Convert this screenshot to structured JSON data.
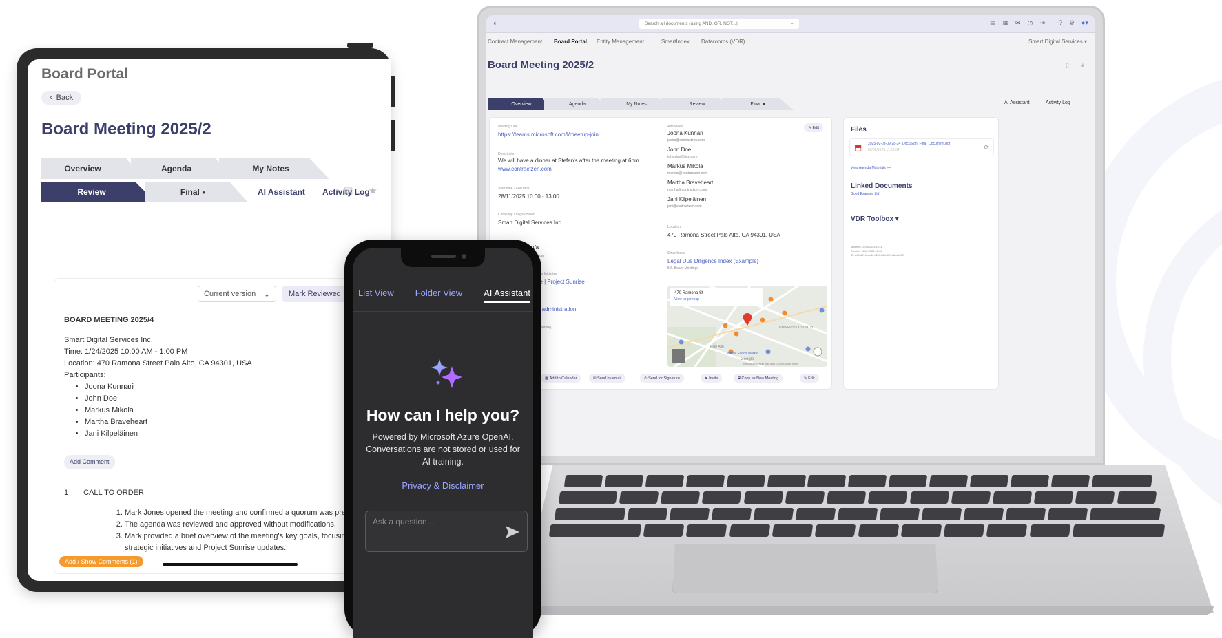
{
  "tablet": {
    "app_title": "Board Portal",
    "back_label": "Back",
    "meeting_title": "Board Meeting 2025/2",
    "tabs": [
      "Overview",
      "Agenda",
      "My Notes",
      "Review",
      "Final"
    ],
    "active_tab": "Review",
    "final_dot": "●",
    "links": [
      "AI Assistant",
      "Activity Log"
    ],
    "version_select": "Current version",
    "mark_reviewed": "Mark Reviewed",
    "doc": {
      "heading": "BOARD MEETING 2025/4",
      "company": "Smart Digital Services Inc.",
      "time": "Time: 1/24/2025 10:00 AM - 1:00 PM",
      "location": "Location: 470 Ramona Street  Palo Alto, CA 94301, USA",
      "participants_label": "Participants:",
      "participants": [
        "Joona Kunnari",
        "John Doe",
        "Markus Mikola",
        "Martha Braveheart",
        "Jani Kilpeläinen"
      ],
      "add_comment": "Add Comment",
      "section_number": "1",
      "section_title": "CALL TO ORDER",
      "items": [
        "Mark Jones opened the meeting and confirmed a quorum was present.",
        "The agenda was reviewed and approved without modifications.",
        "Mark provided a brief overview of the meeting's key goals, focusing on strategic initiatives and Project Sunrise updates."
      ],
      "show_comments": "Add / Show Comments (1)"
    }
  },
  "phone": {
    "tabs": [
      "List View",
      "Folder View",
      "AI Assistant"
    ],
    "active_tab": "AI Assistant",
    "heading": "How can I help you?",
    "subtitle": "Powered by Microsoft Azure OpenAI. Conversations are not stored or used for AI training.",
    "link": "Privacy & Disclaimer",
    "input_placeholder": "Ask a question..."
  },
  "laptop": {
    "search_placeholder": "Search all documents (using AND, OR, NOT...)",
    "nav": [
      "Contract Management",
      "Board Portal",
      "Entity Management",
      "SmartIndex",
      "Datarooms (VDR)"
    ],
    "org_selector": "Smart Digital Services ▾",
    "meeting_title": "Board Meeting 2025/2",
    "tabs": [
      "Overview",
      "Agenda",
      "My Notes",
      "Review",
      "Final ●"
    ],
    "links": [
      "AI Assistant",
      "Activity Log"
    ],
    "meeting_link_label": "Meeting Link",
    "meeting_link": "https://teams.microsoft.com/l/meetup-join...",
    "description_label": "Description",
    "description": "We will have a dinner at Stefan's after the meeting at 6pm.",
    "description_link": "www.contractzen.com",
    "time_label": "Start time - End time",
    "time": "28/11/2025 10.00 - 13.00",
    "company_label": "Company / Organization",
    "company": "Smart Digital Services Inc.",
    "partial_texts": [
      "n/a",
      "zen.com",
      "Case or Initiative",
      "ative | Project Sunrise",
      "and administration",
      "(days before)"
    ],
    "edit_label": "Edit",
    "attendees_label": "Attendees",
    "attendees": [
      {
        "name": "Joona Kunnari",
        "email": "joona@contractzen.com"
      },
      {
        "name": "John Doe",
        "email": "john.doe@firm.com"
      },
      {
        "name": "Markus Mikola",
        "email": "markus@contractzen.com"
      },
      {
        "name": "Martha Braveheart",
        "email": "martha@contractzen.com"
      },
      {
        "name": "Jani Kilpeläinen",
        "email": "jani@contractzen.com"
      }
    ],
    "location_label": "Location",
    "location": "470 Ramona Street Palo Alto, CA 94301, USA",
    "smartindex_label": "SmartIndex",
    "smartindex_link": "Legal Due Diligence Index (Example)",
    "smartindex_sub": "5.6. Board Meetings",
    "map_title": "470 Ramona St",
    "map_link": "View larger map",
    "map_labels": [
      "UNIVERSITY SOUTH",
      "Palo Alto",
      "Whole Foods Market",
      "Google",
      "Keyboard shortcuts  Map data ©2025 Google  Terms"
    ],
    "actions": [
      "Add to Calendar",
      "Send by email",
      "Send for Signature",
      "Invite",
      "Copy as New Meeting",
      "Edit"
    ],
    "files_title": "Files",
    "file_name": "2025-02-03-09-28-24_DocuSign_Final_Document.pdf",
    "file_date": "03/02/2025 11:28:34",
    "view_agenda": "View Agenda Materials >>",
    "linked_title": "Linked Documents",
    "linked_item": "Good Example Ltd",
    "vdr_title": "VDR Toolbox ▾",
    "meta": [
      "Modified: 02/10/2025 14:18",
      "Created: 28/11/2024 15:44",
      "ID: a47a601fe-ac40-4213-a2fc-0f7ca8c4b803"
    ]
  }
}
